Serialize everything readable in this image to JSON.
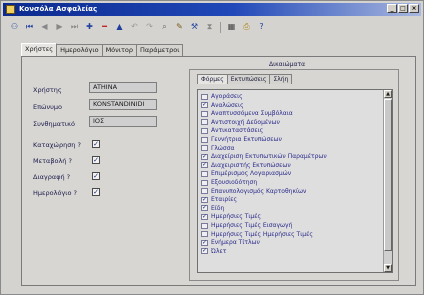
{
  "window": {
    "title": "Κονσόλα Ασφαλείας"
  },
  "tabs": [
    "Χρήστες",
    "Ημερολόγιο",
    "Μόνιτορ",
    "Παράμετροι"
  ],
  "user_form": {
    "username_label": "Χρήστης",
    "username_value": "ATHINA",
    "surname_label": "Επώνυμο",
    "surname_value": "KONSTANDINIDI",
    "password_label": "Συνθηματικό",
    "password_value": "ΙΟΣ"
  },
  "flags": [
    {
      "label": "Καταχώρηση ?",
      "checked": true
    },
    {
      "label": "Μεταβολή ?",
      "checked": true
    },
    {
      "label": "Διαγραφή ?",
      "checked": true
    },
    {
      "label": "Ημερολόγιο ?",
      "checked": true
    }
  ],
  "permissions": {
    "title": "Δικαιώματα",
    "sub_tabs": [
      "Φόρμες",
      "Εκτυπώσεις",
      "Σλήη"
    ],
    "items": [
      {
        "label": "Αγοράσεις",
        "checked": false
      },
      {
        "label": "Αναλώσεις",
        "checked": true
      },
      {
        "label": "Αναπτυσσόμενα Συμβόλαια",
        "checked": false
      },
      {
        "label": "Αντιστοιχή Δεδομένων",
        "checked": false
      },
      {
        "label": "Αντικαταστάσεις",
        "checked": false
      },
      {
        "label": "Γεννήτρια Εκτυπώσεων",
        "checked": false
      },
      {
        "label": "Γλώσσα",
        "checked": false
      },
      {
        "label": "Διαχείριση Εκτυπωτικών Παραμέτρων",
        "checked": true
      },
      {
        "label": "Διαχειριστής Εκτυπώσεων",
        "checked": true
      },
      {
        "label": "Επιμέρισμος Λογαριασμών",
        "checked": false
      },
      {
        "label": "Εξουσιοδότηση",
        "checked": false
      },
      {
        "label": "Επανυπολογισμός Καρτοθηκίων",
        "checked": false
      },
      {
        "label": "Εταιρίες",
        "checked": true
      },
      {
        "label": "Είδη",
        "checked": true
      },
      {
        "label": "Ημερήσιες Τιμές",
        "checked": true
      },
      {
        "label": "Ημερήσιες Τιμές Εισαγωγή",
        "checked": false
      },
      {
        "label": "Ημερήσιες Τιμές Ημερήσιες Τιμές",
        "checked": false
      },
      {
        "label": "Ενήμερα Τίτλων",
        "checked": true
      },
      {
        "label": "Ώλετ",
        "checked": true
      }
    ]
  }
}
